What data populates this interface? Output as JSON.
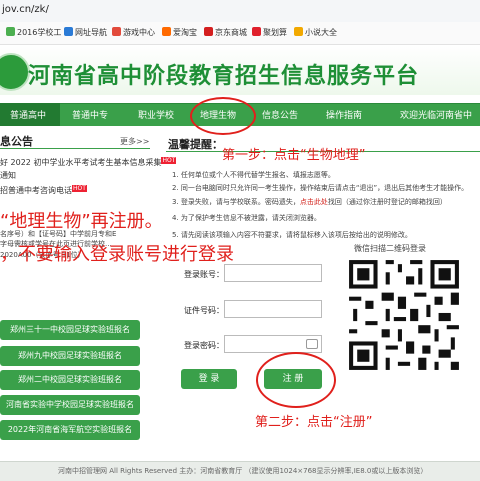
{
  "browser": {
    "address": "jov.cn/zk/",
    "bookmarks": [
      "2016学校工",
      "网址导航",
      "游戏中心",
      "爱淘宝",
      "京东商城",
      "聚划算",
      "小说大全"
    ]
  },
  "header": {
    "title": "河南省高中阶段教育招生信息服务平台"
  },
  "nav": {
    "items": [
      "普通高中",
      "普通中专",
      "职业学校",
      "地理生物",
      "信息公告",
      "操作指南"
    ],
    "welcome": "欢迎光临河南省中"
  },
  "notice": {
    "title": "息公告",
    "more": "更多>>",
    "items": [
      "好 2022 初中学业水平考试考生基本信息采集",
      "通知",
      "招普通中考咨询电话"
    ],
    "partial_lines": [
      "名序号）和【证号码】中学前月专和E",
      "字母需核或学号在此页进行前学校...",
      "2020A00（该序号 11位）"
    ]
  },
  "left_buttons": [
    "郑州三十一中校园足球实验班报名",
    "郑州九中校园足球实验班报名",
    "郑州二中校园足球实验班报名",
    "河南省实验中学校园足球实验班报名",
    "2022年河南省海军航空实验班报名"
  ],
  "tips": {
    "title": "温馨提醒：",
    "lines": [
      "1. 任何单位或个人不得代替学生报名、填报志愿等。",
      "2. 同一台电脑同时只允许同一考生操作，操作结束后请点击“退出”，退出后其他考生才能操作。",
      "3. 登录失败，请与学校联系。密码遗失，",
      "4. 为了保护考生信息不被泄露，请关闭浏览器。",
      "5. 请先阅读该项输入内容不符要求，请将鼠标移入该项后按给出的说明修改。"
    ],
    "reset_link": "点击此处",
    "reset_tail": "找回（通过你注册时登记的邮箱找回）"
  },
  "login": {
    "account_label": "登录账号：",
    "id_label": "证件号码：",
    "password_label": "登录密码：",
    "login_button": "登 录",
    "register_button": "注 册"
  },
  "wechat": {
    "label": "微信扫描二维码登录"
  },
  "annotations": {
    "step1": "第一步：点击“生物地理”",
    "step2": "第二步：点击“注册”",
    "big_line1": "“地理生物”再注册。",
    "big_line2": "，不要输入登录账号进行登录"
  },
  "footer": "河南中招管理网 All Rights Reserved 主办：河南省教育厅 （建议使用1024×768显示分辨率,IE8.0或以上版本浏览）",
  "colors": {
    "brand_green": "#3aa04a",
    "annotation_red": "#e0201c"
  }
}
